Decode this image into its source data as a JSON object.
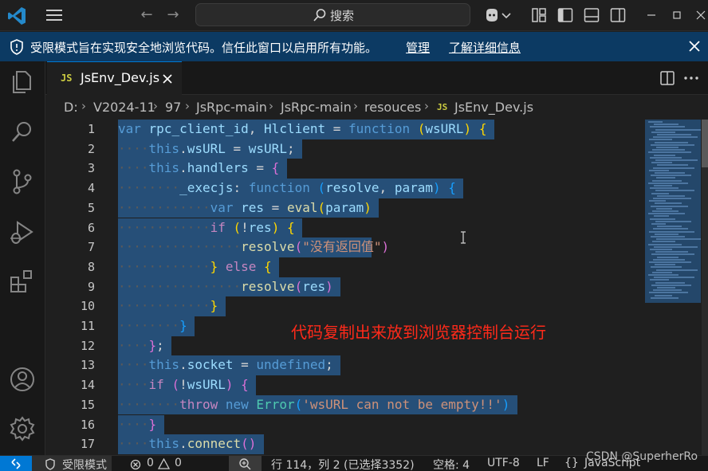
{
  "titlebar": {
    "search_label": "搜索",
    "icons": [
      "vscode-logo",
      "menu-icon",
      "back-arrow-icon",
      "forward-arrow-icon",
      "search-icon",
      "copilot-icon",
      "layout-icon",
      "toggle-primary-sidebar-icon",
      "toggle-panel-icon",
      "toggle-secondary-sidebar-icon"
    ]
  },
  "banner": {
    "message": "受限模式旨在实现安全地浏览代码。信任此窗口以启用所有功能。",
    "manage_label": "管理",
    "learn_more_label": "了解详细信息"
  },
  "activity_bar": {
    "items": [
      "explorer-icon",
      "search-icon",
      "source-control-icon",
      "run-debug-icon",
      "extensions-icon"
    ],
    "bottom": [
      "accounts-icon",
      "settings-gear-icon"
    ]
  },
  "tab": {
    "badge": "JS",
    "label": "JsEnv_Dev.js"
  },
  "breadcrumb": {
    "items": [
      "D:",
      "V2024-11",
      "97",
      "JsRpc-main",
      "JsRpc-main",
      "resouces"
    ],
    "file_badge": "JS",
    "file": "JsEnv_Dev.js"
  },
  "editor": {
    "line_numbers": [
      "1",
      "2",
      "3",
      "4",
      "5",
      "6",
      "7",
      "8",
      "9",
      "10",
      "11",
      "12",
      "13",
      "14",
      "15",
      "16",
      "17"
    ],
    "annotation": "代码复制出来放到浏览器控制台运行",
    "lines": [
      {
        "indent": "",
        "tokens": [
          [
            "kw",
            "var"
          ],
          [
            "p",
            " "
          ],
          [
            "var",
            "rpc_client_id"
          ],
          [
            "p",
            ", "
          ],
          [
            "var",
            "Hlclient"
          ],
          [
            "p",
            " = "
          ],
          [
            "kw",
            "function"
          ],
          [
            "p",
            " "
          ],
          [
            "b1",
            "("
          ],
          [
            "var",
            "wsURL"
          ],
          [
            "b1",
            ")"
          ],
          [
            "p",
            " "
          ],
          [
            "b1",
            "{"
          ]
        ]
      },
      {
        "indent": "····",
        "tokens": [
          [
            "kw",
            "this"
          ],
          [
            "p",
            "."
          ],
          [
            "var",
            "wsURL"
          ],
          [
            "p",
            " = "
          ],
          [
            "var",
            "wsURL"
          ],
          [
            "p",
            ";"
          ]
        ]
      },
      {
        "indent": "····",
        "tokens": [
          [
            "kw",
            "this"
          ],
          [
            "p",
            "."
          ],
          [
            "var",
            "handlers"
          ],
          [
            "p",
            " = "
          ],
          [
            "b2",
            "{"
          ]
        ]
      },
      {
        "indent": "········",
        "tokens": [
          [
            "var",
            "_execjs"
          ],
          [
            "p",
            ": "
          ],
          [
            "kw",
            "function"
          ],
          [
            "p",
            " "
          ],
          [
            "b3",
            "("
          ],
          [
            "var",
            "resolve"
          ],
          [
            "p",
            ", "
          ],
          [
            "var",
            "param"
          ],
          [
            "b3",
            ")"
          ],
          [
            "p",
            " "
          ],
          [
            "b3",
            "{"
          ]
        ]
      },
      {
        "indent": "············",
        "tokens": [
          [
            "kw",
            "var"
          ],
          [
            "p",
            " "
          ],
          [
            "var",
            "res"
          ],
          [
            "p",
            " = "
          ],
          [
            "fn",
            "eval"
          ],
          [
            "b1",
            "("
          ],
          [
            "var",
            "param"
          ],
          [
            "b1",
            ")"
          ]
        ]
      },
      {
        "indent": "············",
        "tokens": [
          [
            "kw2",
            "if"
          ],
          [
            "p",
            " "
          ],
          [
            "b1",
            "("
          ],
          [
            "p",
            "!"
          ],
          [
            "var",
            "res"
          ],
          [
            "b1",
            ")"
          ],
          [
            "p",
            " "
          ],
          [
            "b1",
            "{"
          ]
        ]
      },
      {
        "indent": "················",
        "tokens": [
          [
            "fn",
            "resolve"
          ],
          [
            "b2",
            "("
          ],
          [
            "str",
            "\"没有返回值\""
          ],
          [
            "b2",
            ")"
          ]
        ]
      },
      {
        "indent": "············",
        "tokens": [
          [
            "b1",
            "}"
          ],
          [
            "p",
            " "
          ],
          [
            "kw2",
            "else"
          ],
          [
            "p",
            " "
          ],
          [
            "b1",
            "{"
          ]
        ]
      },
      {
        "indent": "················",
        "tokens": [
          [
            "fn",
            "resolve"
          ],
          [
            "b2",
            "("
          ],
          [
            "var",
            "res"
          ],
          [
            "b2",
            ")"
          ]
        ]
      },
      {
        "indent": "············",
        "tokens": [
          [
            "b1",
            "}"
          ]
        ]
      },
      {
        "indent": "········",
        "tokens": [
          [
            "b3",
            "}"
          ]
        ]
      },
      {
        "indent": "····",
        "tokens": [
          [
            "b2",
            "}"
          ],
          [
            "p",
            ";"
          ]
        ]
      },
      {
        "indent": "····",
        "tokens": [
          [
            "kw",
            "this"
          ],
          [
            "p",
            "."
          ],
          [
            "var",
            "socket"
          ],
          [
            "p",
            " = "
          ],
          [
            "kw",
            "undefined"
          ],
          [
            "p",
            ";"
          ]
        ]
      },
      {
        "indent": "····",
        "tokens": [
          [
            "kw2",
            "if"
          ],
          [
            "p",
            " "
          ],
          [
            "b2",
            "("
          ],
          [
            "p",
            "!"
          ],
          [
            "var",
            "wsURL"
          ],
          [
            "b2",
            ")"
          ],
          [
            "p",
            " "
          ],
          [
            "b2",
            "{"
          ]
        ]
      },
      {
        "indent": "········",
        "tokens": [
          [
            "kw2",
            "throw"
          ],
          [
            "p",
            " "
          ],
          [
            "kw",
            "new"
          ],
          [
            "p",
            " "
          ],
          [
            "cls",
            "Error"
          ],
          [
            "b3",
            "("
          ],
          [
            "str",
            "'wsURL can not be empty!!'"
          ],
          [
            "b3",
            ")"
          ]
        ]
      },
      {
        "indent": "····",
        "tokens": [
          [
            "b2",
            "}"
          ]
        ]
      },
      {
        "indent": "····",
        "tokens": [
          [
            "kw",
            "this"
          ],
          [
            "p",
            "."
          ],
          [
            "fn",
            "connect"
          ],
          [
            "b2",
            "()"
          ]
        ]
      }
    ]
  },
  "statusbar": {
    "restricted": "受限模式",
    "errors": "0",
    "warnings": "0",
    "position": "行 114，列 2 (已选择3352)",
    "spaces": "空格: 4",
    "encoding": "UTF-8",
    "eol": "LF",
    "braces": "{}",
    "language": "JavaScript"
  },
  "watermark": "CSDN @SuperherRo",
  "colors": {
    "accent": "#0078d4",
    "banner": "#0c3a63",
    "selection": "#264f78",
    "annotation": "#ff2a1a"
  }
}
